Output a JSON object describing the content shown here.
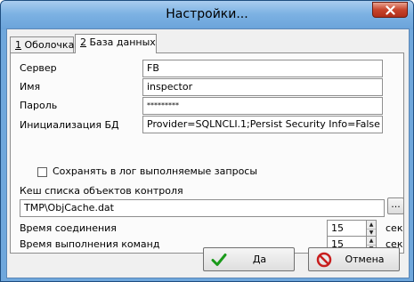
{
  "window": {
    "title": "Настройки..."
  },
  "tabs": [
    {
      "mnemonic": "1",
      "label": " Оболочка",
      "active": false
    },
    {
      "mnemonic": "2",
      "label": " База данных",
      "active": true
    }
  ],
  "form": {
    "server": {
      "label": "Сервер",
      "value": "FB"
    },
    "name": {
      "label": "Имя",
      "value": "inspector"
    },
    "password": {
      "label": "Пароль",
      "value": "*********"
    },
    "init": {
      "label": "Инициализация БД",
      "value": "Provider=SQLNCLI.1;Persist Security Info=False"
    },
    "log_queries": {
      "label": "Сохранять в лог выполняемые запросы",
      "checked": false
    },
    "cache": {
      "label": "Кеш списка объектов контроля",
      "value": "TMP\\ObjCache.dat",
      "browse_label": "..."
    },
    "connect_time": {
      "label": "Время соединения",
      "value": "15",
      "unit": "сек"
    },
    "command_time": {
      "label": "Время выполнения команд",
      "value": "15",
      "unit": "сек"
    }
  },
  "buttons": {
    "ok": "Да",
    "cancel": "Отмена"
  },
  "icons": {
    "close": "close-icon",
    "ok": "checkmark-icon",
    "cancel": "no-entry-icon",
    "spin_up": "spin-up-arrow",
    "spin_down": "spin-down-arrow"
  },
  "colors": {
    "titlebar": "#7db2e3",
    "close_button": "#c7442c",
    "ok_check": "#1a9a1a",
    "cancel_icon": "#c81e1e"
  }
}
